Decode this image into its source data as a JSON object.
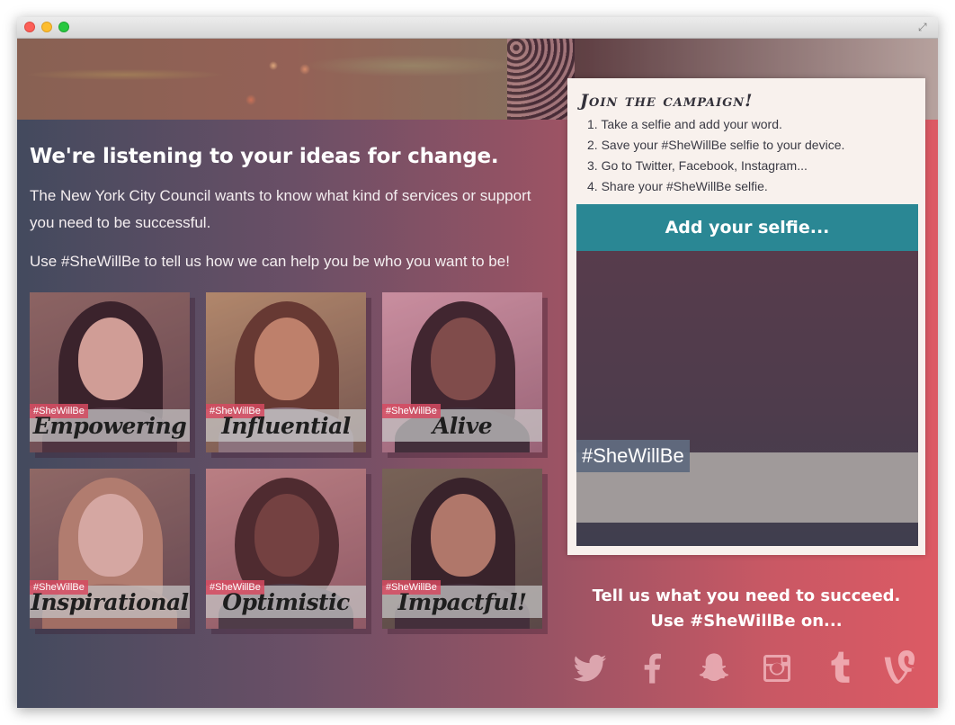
{
  "page": {
    "headline": "We're listening to your ideas for change.",
    "intro": "The New York City Council wants to know what kind of services or support you need to be successful.",
    "cta": "Use #SheWillBe to tell us how we can help you be who you want to be!"
  },
  "tiles": [
    {
      "tag": "#SheWillBe",
      "word": "Empowering"
    },
    {
      "tag": "#SheWillBe",
      "word": "Influential"
    },
    {
      "tag": "#SheWillBe",
      "word": "Alive"
    },
    {
      "tag": "#SheWillBe",
      "word": "Inspirational"
    },
    {
      "tag": "#SheWillBe",
      "word": "Optimistic"
    },
    {
      "tag": "#SheWillBe",
      "word": "Impactful!"
    }
  ],
  "join": {
    "title": "Join the campaign!",
    "steps": [
      "1. Take a selfie and add your word.",
      "2. Save your #SheWillBe selfie to your device.",
      "3. Go to Twitter, Facebook, Instagram...",
      "4. Share your #SheWillBe selfie."
    ],
    "add_selfie_label": "Add your selfie...",
    "selfie_tag": "#SheWillBe"
  },
  "footer": {
    "line1": "Tell us what you need to succeed.",
    "line2": "Use #SheWillBe on..."
  },
  "social_icons": [
    "twitter-icon",
    "facebook-icon",
    "snapchat-icon",
    "instagram-icon",
    "tumblr-icon",
    "vine-icon"
  ],
  "colors": {
    "gradient_left": "#434a5e",
    "gradient_right": "#dc5a64",
    "selfie_button": "#2a8794",
    "panel_bg": "#f8f1ed",
    "tag_bg": "#d64a60"
  }
}
